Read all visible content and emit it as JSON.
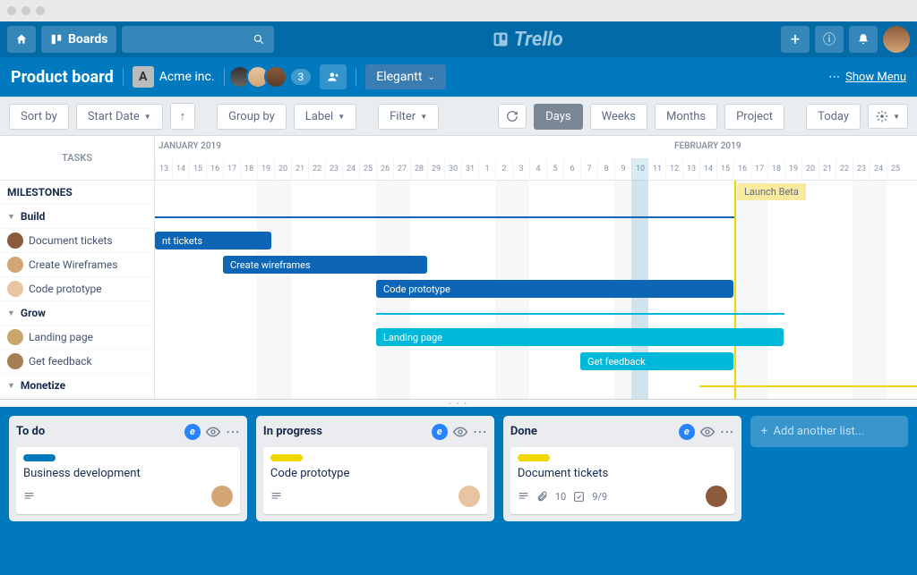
{
  "topbar": {
    "boards_label": "Boards",
    "brand": "Trello"
  },
  "board": {
    "title": "Product board",
    "workspace_letter": "A",
    "workspace_name": "Acme inc.",
    "extra_members": "3",
    "plugin_name": "Elegantt",
    "show_menu": "Show Menu"
  },
  "toolbar": {
    "sort_by": "Sort by",
    "start_date": "Start Date",
    "group_by": "Group by",
    "label": "Label",
    "filter": "Filter",
    "days": "Days",
    "weeks": "Weeks",
    "months": "Months",
    "project": "Project",
    "today": "Today"
  },
  "gantt": {
    "tasks_header": "TASKS",
    "milestones": "MILESTONES",
    "sections": [
      {
        "name": "Build",
        "tasks": [
          "Document tickets",
          "Create Wireframes",
          "Code prototype"
        ]
      },
      {
        "name": "Grow",
        "tasks": [
          "Landing page",
          "Get feedback"
        ]
      },
      {
        "name": "Monetize",
        "tasks": []
      }
    ],
    "months": [
      {
        "label": "JANUARY 2019"
      },
      {
        "label": "FEBRUARY 2019"
      }
    ],
    "days": [
      "13",
      "14",
      "15",
      "16",
      "17",
      "18",
      "19",
      "20",
      "21",
      "22",
      "23",
      "24",
      "25",
      "26",
      "27",
      "28",
      "29",
      "30",
      "31",
      "1",
      "2",
      "3",
      "4",
      "5",
      "6",
      "7",
      "8",
      "9",
      "10",
      "11",
      "12",
      "13",
      "14",
      "15",
      "16",
      "17",
      "18",
      "19",
      "20",
      "21",
      "22",
      "23",
      "24",
      "25"
    ],
    "milestone_label": "Launch Beta",
    "bars": {
      "doc": "nt tickets",
      "wire": "Create wireframes",
      "code": "Code prototype",
      "landing": "Landing page",
      "feedback": "Get feedback"
    }
  },
  "lists": [
    {
      "title": "To do",
      "card": {
        "label": "blue",
        "title": "Business development",
        "badges": {
          "desc": true
        }
      }
    },
    {
      "title": "In progress",
      "card": {
        "label": "yellow",
        "title": "Code prototype",
        "badges": {
          "desc": true
        }
      }
    },
    {
      "title": "Done",
      "card": {
        "label": "yellow",
        "title": "Document tickets",
        "badges": {
          "desc": true,
          "attach": "10",
          "check": "9/9"
        }
      }
    }
  ],
  "add_list": "Add another list..."
}
